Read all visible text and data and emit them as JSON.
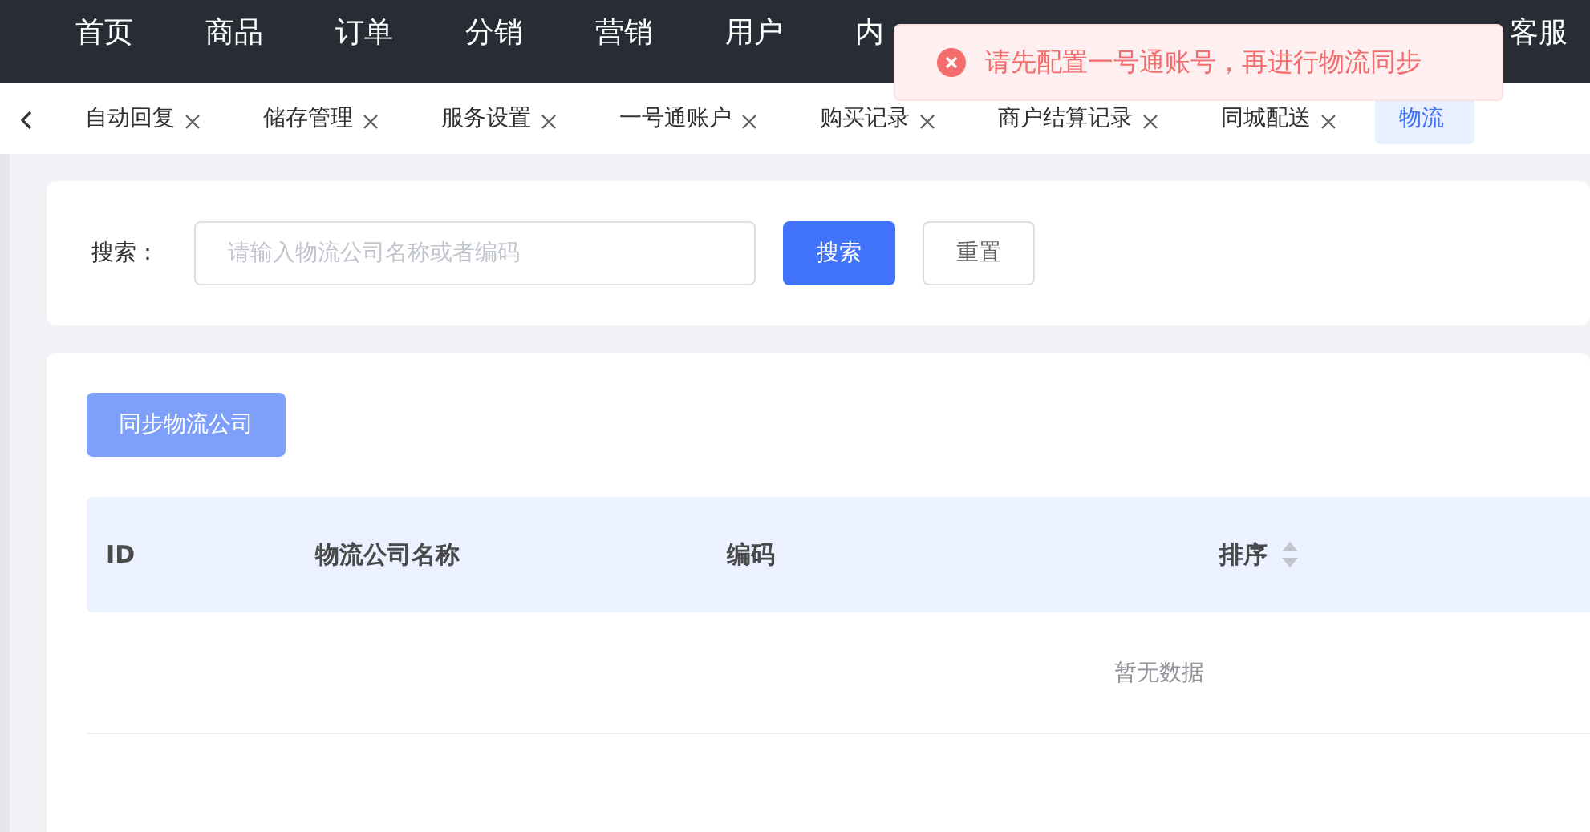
{
  "nav": {
    "items": [
      {
        "label": "首页"
      },
      {
        "label": "商品"
      },
      {
        "label": "订单"
      },
      {
        "label": "分销"
      },
      {
        "label": "营销"
      },
      {
        "label": "用户"
      },
      {
        "label": "内"
      }
    ],
    "right_item": "客服"
  },
  "toast": {
    "kind": "error",
    "message": "请先配置一号通账号，再进行物流同步"
  },
  "tabs": [
    {
      "label": "自动回复",
      "selected": false
    },
    {
      "label": "储存管理",
      "selected": false
    },
    {
      "label": "服务设置",
      "selected": false
    },
    {
      "label": "一号通账户",
      "selected": false
    },
    {
      "label": "购买记录",
      "selected": false
    },
    {
      "label": "商户结算记录",
      "selected": false
    },
    {
      "label": "同城配送",
      "selected": false
    },
    {
      "label": "物流",
      "selected": true
    }
  ],
  "search": {
    "label": "搜索：",
    "placeholder": "请输入物流公司名称或者编码",
    "buttons": [
      "搜索",
      "重置"
    ]
  },
  "sync_button": {
    "label": "同步物流公司",
    "disabled": true
  },
  "table": {
    "columns": [
      {
        "label": "ID",
        "sortable": false
      },
      {
        "label": "物流公司名称",
        "sortable": false
      },
      {
        "label": "编码",
        "sortable": false
      },
      {
        "label": "排序",
        "sortable": true
      }
    ],
    "empty_text": "暂无数据"
  }
}
